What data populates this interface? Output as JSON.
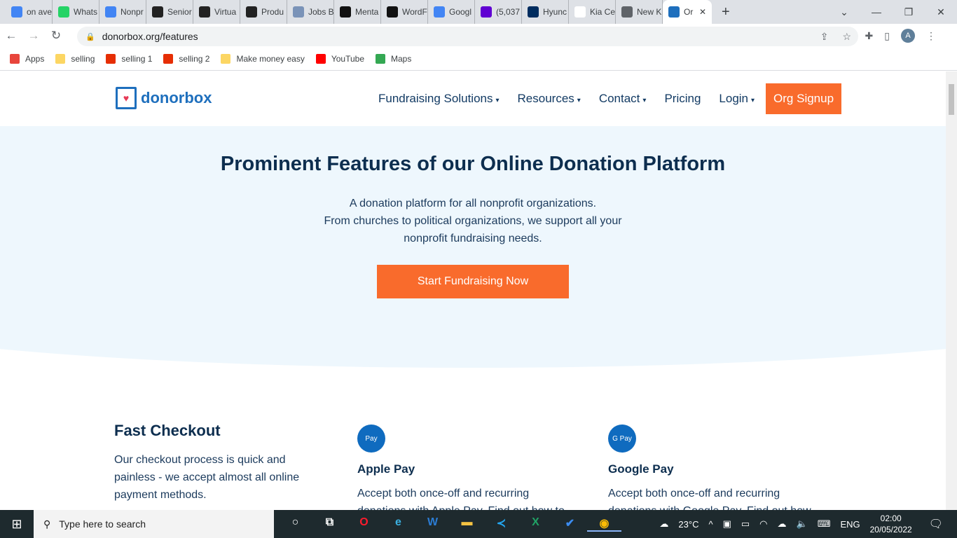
{
  "browser": {
    "tabs": [
      {
        "label": "on ave",
        "icon": "google-icon",
        "color": "#4285f4"
      },
      {
        "label": "Whats",
        "icon": "whatsapp-icon",
        "color": "#25d366"
      },
      {
        "label": "Nonpr",
        "icon": "google-docs-icon",
        "color": "#4285f4"
      },
      {
        "label": "Senior",
        "icon": "r-icon",
        "color": "#222"
      },
      {
        "label": "Virtua",
        "icon": "r-icon",
        "color": "#222"
      },
      {
        "label": "Produ",
        "icon": "r-icon",
        "color": "#222"
      },
      {
        "label": "Jobs B",
        "icon": "globe-seal-icon",
        "color": "#7a93b8"
      },
      {
        "label": "Menta",
        "icon": "circle-icon",
        "color": "#111"
      },
      {
        "label": "WordF",
        "icon": "wordfence-icon",
        "color": "#111"
      },
      {
        "label": "Googl",
        "icon": "google-icon",
        "color": "#4285f4"
      },
      {
        "label": "(5,037",
        "icon": "mail-icon",
        "color": "#6001d2"
      },
      {
        "label": "Hyunc",
        "icon": "hyundai-icon",
        "color": "#002c5f"
      },
      {
        "label": "Kia Ce",
        "icon": "kia-icon",
        "color": "#fff"
      },
      {
        "label": "New K",
        "icon": "globe-icon",
        "color": "#5f6368"
      },
      {
        "label": "Or",
        "icon": "donorbox-icon",
        "color": "#1e6fbd",
        "active": true
      }
    ],
    "url": "donorbox.org/features",
    "profile": "A",
    "bookmarks": [
      {
        "label": "Apps",
        "icon": "apps-grid-icon",
        "color": "#e8453c"
      },
      {
        "label": "selling",
        "icon": "folder-icon",
        "color": "#fcd663"
      },
      {
        "label": "selling 1",
        "icon": "aliexpress-icon",
        "color": "#e62e04"
      },
      {
        "label": "selling 2",
        "icon": "aliexpress-icon",
        "color": "#e62e04"
      },
      {
        "label": "Make money easy",
        "icon": "folder-icon",
        "color": "#fcd663"
      },
      {
        "label": "YouTube",
        "icon": "youtube-icon",
        "color": "#ff0000"
      },
      {
        "label": "Maps",
        "icon": "maps-icon",
        "color": "#34a853"
      }
    ]
  },
  "site": {
    "logo": "donorbox",
    "nav": [
      {
        "label": "Fundraising Solutions",
        "dropdown": true
      },
      {
        "label": "Resources",
        "dropdown": true
      },
      {
        "label": "Contact",
        "dropdown": true
      },
      {
        "label": "Pricing",
        "dropdown": false
      },
      {
        "label": "Login",
        "dropdown": true
      }
    ],
    "signup": "Org Signup",
    "hero": {
      "title": "Prominent Features of our Online Donation Platform",
      "lines": [
        "A donation platform for all nonprofit organizations.",
        "From churches to political organizations, we support all your",
        "nonprofit fundraising needs."
      ],
      "cta": "Start Fundraising Now"
    },
    "features": {
      "title": "Fast Checkout",
      "description": "Our checkout process is quick and painless - we accept almost all online payment methods.",
      "items": [
        {
          "icon_text": " Pay",
          "title": "Apple Pay",
          "description": "Accept both once-off and recurring donations with Apple Pay. Find out how to"
        },
        {
          "icon_text": "G Pay",
          "title": "Google Pay",
          "description": "Accept both once-off and recurring donations with Google Pay. Find out how to"
        }
      ]
    },
    "colors": {
      "accent": "#f96b2c",
      "brand": "#1e6fbd",
      "heading": "#0d2e4f",
      "hero_bg": "#eef7fd"
    }
  },
  "taskbar": {
    "search_placeholder": "Type here to search",
    "weather": "23°C",
    "language": "ENG",
    "time": "02:00",
    "date": "20/05/2022"
  }
}
